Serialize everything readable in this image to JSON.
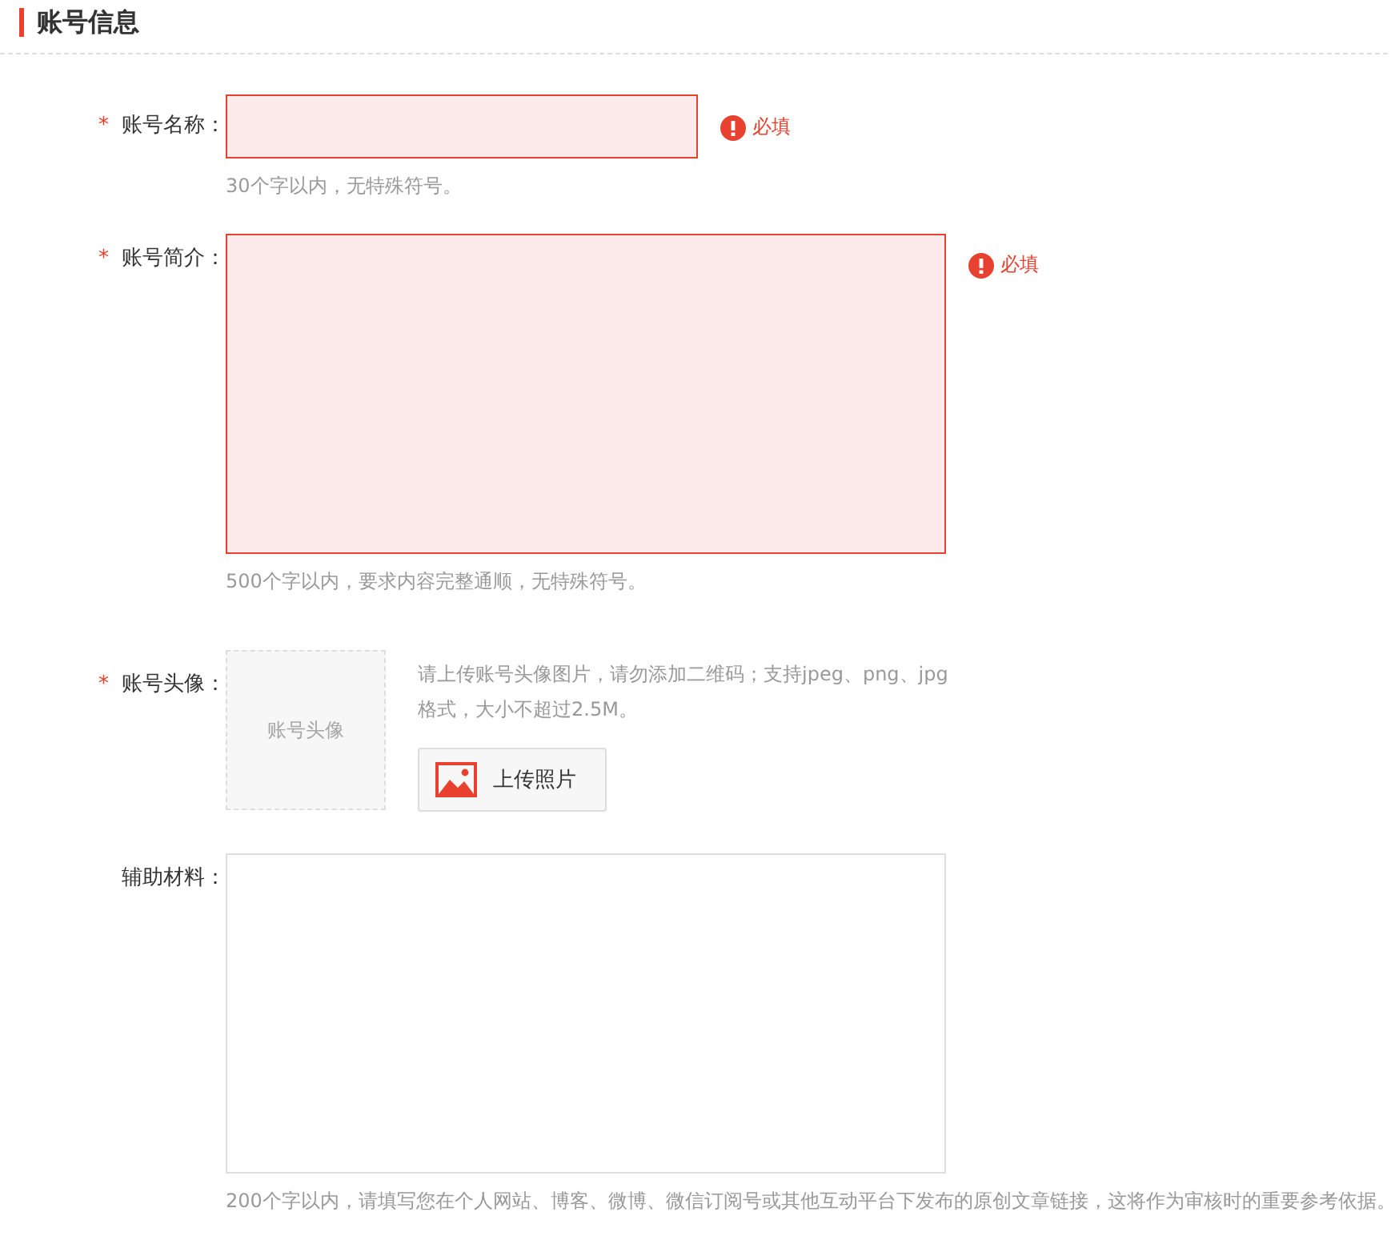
{
  "section_title": "账号信息",
  "fields": [
    {
      "kind": "input",
      "label": "账号名称：",
      "required": true,
      "error": "必填",
      "hint": "30个字以内，无特殊符号。"
    },
    {
      "kind": "textarea",
      "label": "账号简介：",
      "required": true,
      "error": "必填",
      "hint": "500个字以内，要求内容完整通顺，无特殊符号。"
    },
    {
      "kind": "avatar",
      "label": "账号头像：",
      "required": true,
      "placeholder": "账号头像",
      "note": "请上传账号头像图片，请勿添加二维码；支持jpeg、png、jpg格式，大小不超过2.5M。",
      "button": "上传照片"
    },
    {
      "kind": "textarea",
      "label": "辅助材料：",
      "required": false,
      "hint": "200个字以内，请填写您在个人网站、博客、微博、微信订阅号或其他互动平台下发布的原创文章链接，这将作为审核时的重要参考依据。"
    }
  ],
  "required_mark": "*"
}
